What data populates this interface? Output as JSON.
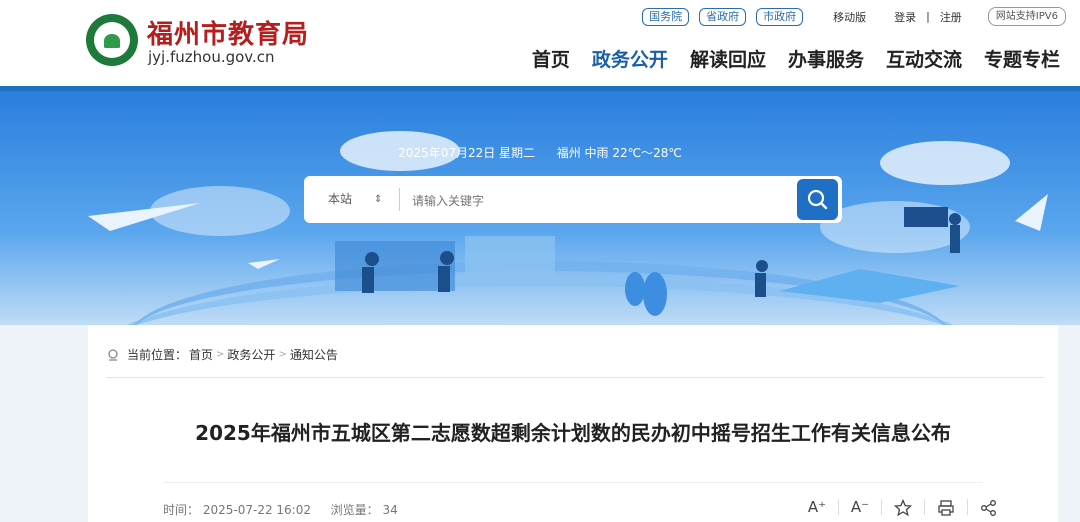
{
  "site": {
    "title": "福州市教育局",
    "domain": "jyj.fuzhou.gov.cn"
  },
  "toplinks": {
    "pills": [
      "国务院",
      "省政府",
      "市政府"
    ],
    "mobile": "移动版",
    "login": "登录",
    "separator": "|",
    "register": "注册",
    "ipv6": "网站支持IPV6"
  },
  "nav": {
    "items": [
      "首页",
      "政务公开",
      "解读回应",
      "办事服务",
      "互动交流",
      "专题专栏"
    ],
    "active": "政务公开"
  },
  "banner": {
    "date": "2025年07月22日 星期二",
    "weather": "福州 中雨 22℃～28℃"
  },
  "search": {
    "scope": "本站",
    "scope_arrow": "⇕",
    "placeholder": "请输入关键字"
  },
  "breadcrumb": {
    "label": "当前位置：",
    "items": [
      "首页",
      "政务公开",
      "通知公告"
    ],
    "separator": ">"
  },
  "article": {
    "title": "2025年福州市五城区第二志愿数超剩余计划数的民办初中摇号招生工作有关信息公布",
    "time_label": "时间：",
    "time": "2025-07-22 16:02",
    "views_label": "浏览量：",
    "views": "34"
  },
  "tools": {
    "font_larger": "A⁺",
    "font_smaller": "A⁻"
  },
  "colors": {
    "brand_red": "#b61d1d",
    "brand_blue": "#1d6fc0"
  }
}
